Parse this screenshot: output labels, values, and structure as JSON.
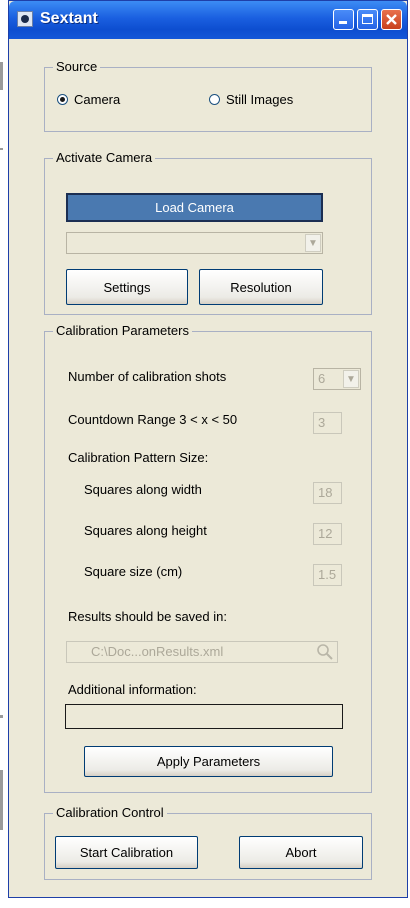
{
  "window": {
    "title": "Sextant"
  },
  "source": {
    "group_label": "Source",
    "options": [
      {
        "label": "Camera",
        "selected": true
      },
      {
        "label": "Still Images",
        "selected": false
      }
    ]
  },
  "activate_camera": {
    "group_label": "Activate Camera",
    "load_button": "Load Camera",
    "camera_select_value": "",
    "settings_button": "Settings",
    "resolution_button": "Resolution"
  },
  "calibration_parameters": {
    "group_label": "Calibration Parameters",
    "shots_label": "Number of calibration shots",
    "shots_value": "6",
    "countdown_label": "Countdown Range 3 < x < 50",
    "countdown_value": "3",
    "pattern_label": "Calibration Pattern Size:",
    "width_label": "Squares along width",
    "width_value": "18",
    "height_label": "Squares along height",
    "height_value": "12",
    "size_label": "Square size (cm)",
    "size_value": "1.5",
    "results_label": "Results should be saved in:",
    "results_path": "C:\\Doc...onResults.xml",
    "info_label": "Additional information:",
    "info_value": "",
    "apply_button": "Apply Parameters"
  },
  "calibration_control": {
    "group_label": "Calibration Control",
    "start_button": "Start Calibration",
    "abort_button": "Abort"
  },
  "colors": {
    "titlebar": "#0d4ed0",
    "window_bg": "#ece9d8",
    "load_button": "#4a79b0"
  },
  "icons": [
    "app-icon",
    "minimize-icon",
    "maximize-icon",
    "close-icon",
    "search-icon",
    "dropdown-arrow-icon"
  ]
}
